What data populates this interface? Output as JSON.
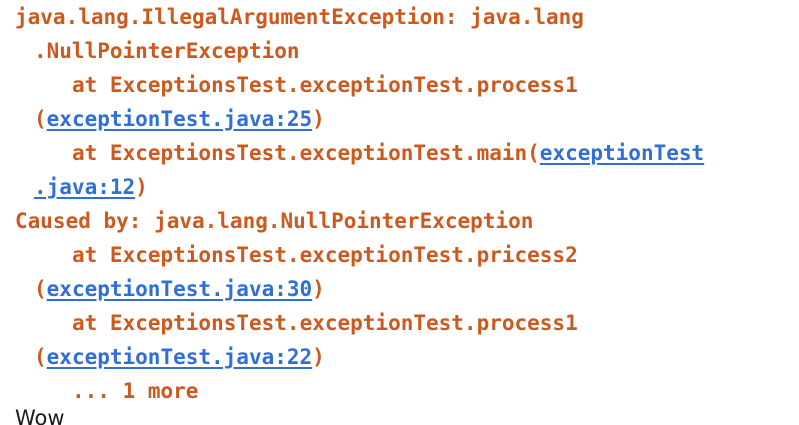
{
  "console": {
    "line1": "java.lang.IllegalArgumentException: java.lang",
    "line2": ".NullPointerException",
    "line3": "at ExceptionsTest.exceptionTest.process1",
    "line4_open": "(",
    "line4_link": "exceptionTest.java:25",
    "line4_close": ")",
    "line5_prefix": "at ExceptionsTest.exceptionTest.main(",
    "line5_link": "exceptionTest",
    "line6_link": ".java:12",
    "line6_close": ")",
    "line7": "Caused by: java.lang.NullPointerException",
    "line8": "at ExceptionsTest.exceptionTest.pricess2",
    "line9_open": "(",
    "line9_link": "exceptionTest.java:30",
    "line9_close": ")",
    "line10": "at ExceptionsTest.exceptionTest.process1",
    "line11_open": "(",
    "line11_link": "exceptionTest.java:22",
    "line11_close": ")",
    "line12": "... 1 more"
  },
  "output": {
    "text": "Wow"
  },
  "colors": {
    "error_text": "#cc5a1e",
    "link": "#2f6fd6",
    "plain_text": "#1a1a1a",
    "background": "#ffffff"
  }
}
